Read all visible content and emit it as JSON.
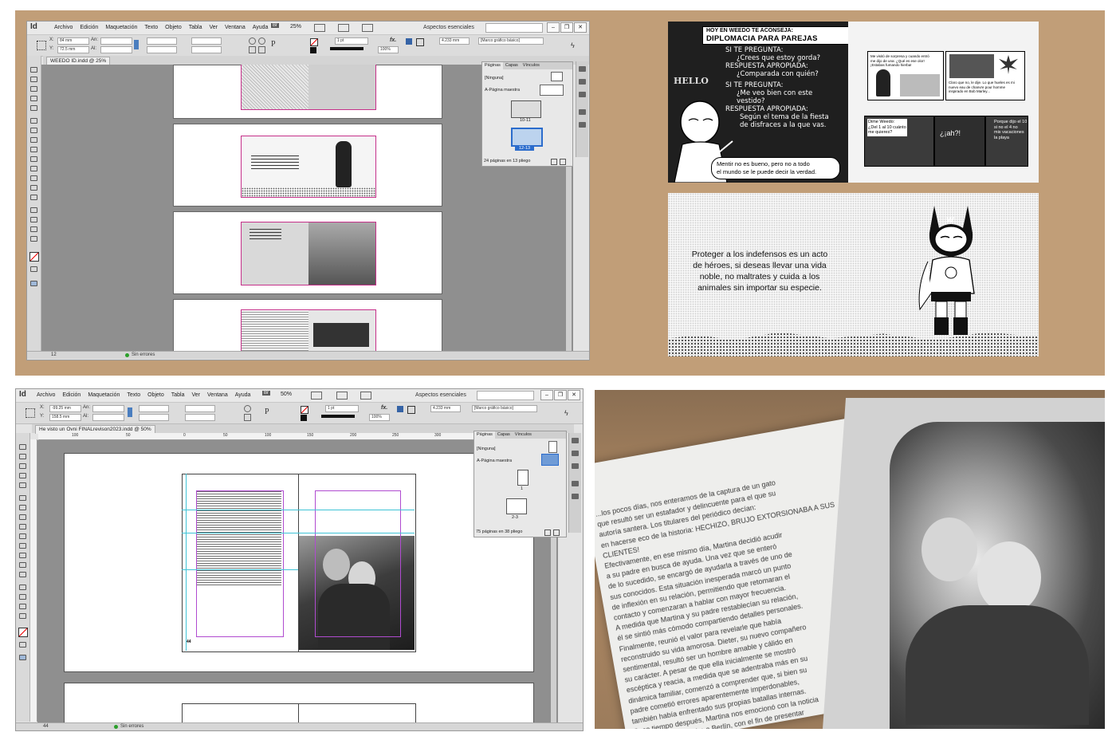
{
  "top_app": {
    "logo": "Id",
    "menus": [
      "Archivo",
      "Edición",
      "Maquetación",
      "Texto",
      "Objeto",
      "Tabla",
      "Ver",
      "Ventana",
      "Ayuda"
    ],
    "br_badge": "Br",
    "zoom": "25%",
    "workspace": "Aspectos esenciales",
    "ctrl": {
      "x_label": "X:",
      "x_value": "84 mm",
      "y_label": "Y:",
      "y_value": "72.5 mm",
      "w_label": "An:",
      "h_label": "Al:",
      "stroke": "1 pt",
      "percent": "100%",
      "dim": "4.233 mm",
      "frame_style": "[Marco gráfico básico]"
    },
    "doc_tab": "WEEDO ID.indd @ 25%",
    "status": {
      "page": "12",
      "errors": "Sin errores"
    },
    "panel": {
      "tabs": [
        "Páginas",
        "Capas",
        "Vínculos"
      ],
      "none_label": "[Ninguna]",
      "master_label": "A-Página maestra",
      "spread_labels": [
        "10-11",
        "12-13"
      ],
      "footer": "24 páginas en 13 pliego"
    }
  },
  "bottom_app": {
    "logo": "Id",
    "menus": [
      "Archivo",
      "Edición",
      "Maquetación",
      "Texto",
      "Objeto",
      "Tabla",
      "Ver",
      "Ventana",
      "Ayuda"
    ],
    "br_badge": "Br",
    "zoom": "50%",
    "workspace": "Aspectos esenciales",
    "ctrl": {
      "x_label": "X:",
      "x_value": "-99.25 mm",
      "y_label": "Y:",
      "y_value": "158.5 mm",
      "w_label": "An:",
      "h_label": "Al:",
      "stroke": "1 pt",
      "percent": "100%",
      "dim": "4.233 mm",
      "frame_style": "[Marco gráfico básico]"
    },
    "doc_tab": "He visto un Ovni FINALrevison2023.indd @ 50%",
    "ruler": [
      "100",
      "50",
      "0",
      "50",
      "100",
      "150",
      "200",
      "250",
      "300"
    ],
    "status": {
      "page": "44",
      "errors": "Sin errores"
    },
    "page_number": "44",
    "panel": {
      "tabs": [
        "Páginas",
        "Capas",
        "Vínculos"
      ],
      "none_label": "[Ninguna]",
      "master_label": "A-Página maestra",
      "spread_labels": [
        "1",
        "2-3"
      ],
      "footer": "75 páginas en 38 pliego"
    }
  },
  "comic1": {
    "header_small": "HOY EN WEEDO TE ACONSEJA:",
    "header_big": "DIPLOMACIA PARA PAREJAS",
    "hello": "HELLO",
    "board_lines": [
      "SI TE PREGUNTA:",
      "¿Crees que estoy gorda?",
      "RESPUESTA APROPIADA:",
      "¿Comparada con quién?",
      "SI TE PREGUNTA:",
      "¿Me veo bien con este",
      "vestido?",
      "RESPUESTA APROPIADA:",
      "Según el tema de la fiesta",
      "de disfraces a la que vas."
    ],
    "caption": "Mentir no es bueno, pero no a todo\nel mundo se le puede decir la verdad.",
    "panel_b_text": "Me visitó de sorpresa y cuando entró\nme dijo de una: ¿Qué es ese olor!\n¡Estabas fumando hierba!",
    "panel_c_text": "Claro que no, le dije. Lo que hueles es mi\nnuevo eau de chanvre pour homme\ninspirado en Bob Marley...",
    "panel_d_text": "Dime Weedo:\n¿Del 1 al 10 cuánto\nme quieres?",
    "panel_d_text2": "¿Del 1 al 10 cuánto\nme quieres?",
    "panel_e_text": "¿¡ah?!",
    "panel_f_text": "Porque dijo el 10\nsi no el 4 no\nmis vacaciones\nla playa"
  },
  "comic2": {
    "text": "Proteger a los indefensos es un acto\nde héroes, si deseas llevar una vida\nnoble, no maltrates y cuida a los\nanimales sin importar su especie.",
    "emblem": "W"
  },
  "book": {
    "left_page": "...los pocos días, nos enteramos de la captura de un gato\nque resultó ser un estafador y delincuente para el que su\nautoría santera. Los titulares del periódico decían:\nen hacerse eco de la historia: HECHIZO, BRUJO EXTORSIONABA A SUS CLIENTES!\nEfectivamente, en ese mismo día, Martina decidió acudir\na su padre en busca de ayuda. Una vez que se enteró\nde lo sucedido, se encargó de ayudarla a través de uno de\nsus conocidos. Esta situación inesperada marcó un punto\nde inflexión en su relación, permitiendo que retomaran el\ncontacto y comenzaran a hablar con mayor frecuencia.\nA medida que Martina y su padre restablecían su relación,\nél se sintió más cómodo compartiendo detalles personales.\nFinalmente, reunió el valor para revelarle que había\nreconstruido su vida amorosa. Dieter, su nuevo compañero\nsentimental, resultó ser un hombre amable y cálido en\nsu carácter. A pesar de que ella inicialmente se mostró\nescéptica y reacia, a medida que se adentraba más en su\ndinámica familiar, comenzó a comprender que, si bien su\npadre cometió errores aparentemente imperdonables,\ntambién había enfrentado sus propias batallas internas.\nPoco tiempo después, Martina nos emocionó con la noticia\nde que viajaría rumbo a Berlín, con el fin de presentar\nformalmente a su prometido ante su padre. Finalmente,\nuna parte de ella había decidido aceptarlo y perdonarlo, otorgándole\nla oportunidad de enmendar su pasado. Increíblemente,"
  },
  "colors": {
    "tan": "#c19e78",
    "indesign_bg": "#e4e4e4",
    "canvas": "#8f8f8f",
    "magenta_guide": "#c6308a",
    "cyan_guide": "#3fc3d6",
    "chalkboard": "#1f1f1f"
  }
}
